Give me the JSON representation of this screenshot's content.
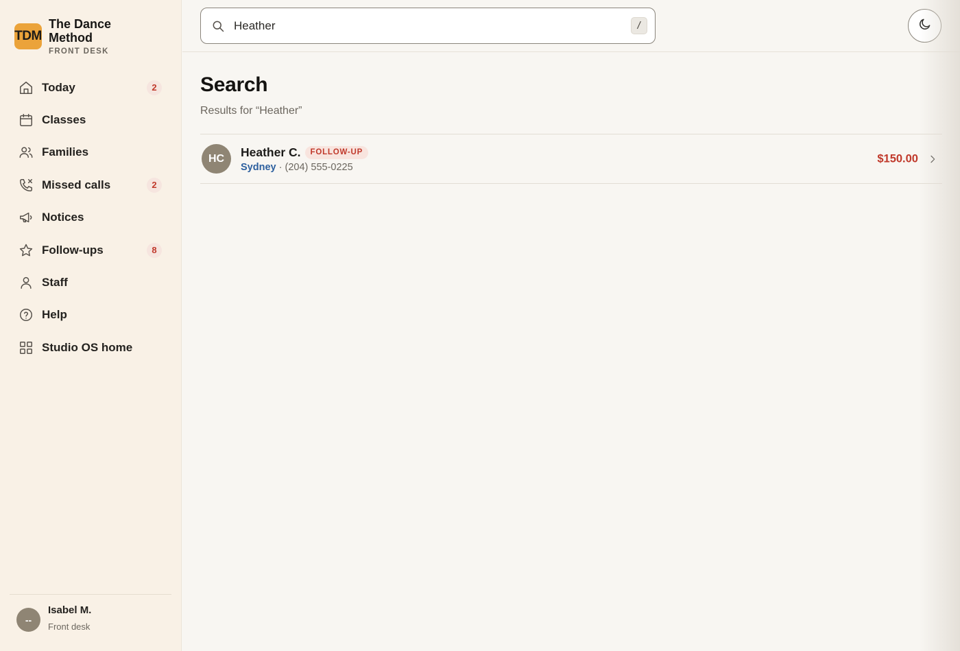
{
  "brand": {
    "logo": "TDM",
    "name": "The Dance Method",
    "subtitle": "FRONT DESK",
    "logo_color": "#eba33a"
  },
  "nav": {
    "items": [
      {
        "label": "Today",
        "icon": "home-icon",
        "badge": "2"
      },
      {
        "label": "Classes",
        "icon": "calendar-icon",
        "badge": ""
      },
      {
        "label": "Families",
        "icon": "users-icon",
        "badge": ""
      },
      {
        "label": "Missed calls",
        "icon": "phone-missed-icon",
        "badge": "2"
      },
      {
        "label": "Notices",
        "icon": "megaphone-icon",
        "badge": ""
      },
      {
        "label": "Follow-ups",
        "icon": "star-icon",
        "badge": "8"
      },
      {
        "label": "Staff",
        "icon": "user-icon",
        "badge": ""
      },
      {
        "label": "Help",
        "icon": "help-circle-icon",
        "badge": ""
      },
      {
        "label": "Studio OS home",
        "icon": "grid-icon",
        "badge": ""
      }
    ]
  },
  "user": {
    "initials": "--",
    "name": "Isabel M.",
    "role": "Front desk"
  },
  "search": {
    "value": "Heather",
    "shortcut": "/"
  },
  "theme_toggle": {
    "icon": "moon-icon"
  },
  "page": {
    "title": "Search",
    "results_for": "Results for “Heather”"
  },
  "results": [
    {
      "initials": "HC",
      "name": "Heather C.",
      "tag": "FOLLOW-UP",
      "location": "Sydney",
      "separator": "·",
      "phone": "(204) 555-0225",
      "amount": "$150.00"
    }
  ],
  "colors": {
    "accent_red": "#c0392b",
    "link_blue": "#2c5f9e",
    "sidebar_bg": "#f9f1e6",
    "page_bg": "#f8f6f2"
  }
}
